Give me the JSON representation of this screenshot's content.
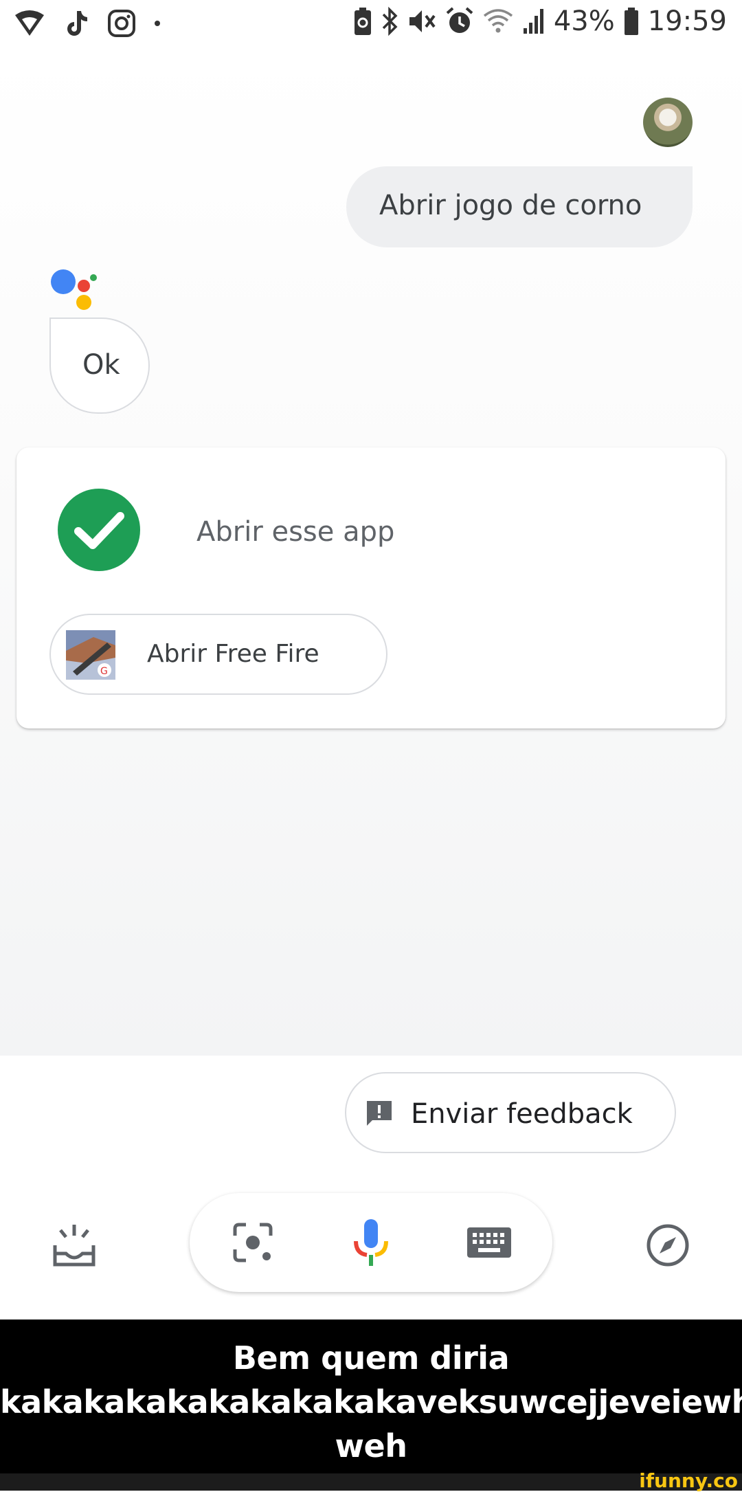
{
  "status_bar": {
    "left_icons": [
      "wifi-shield-icon",
      "tiktok-icon",
      "instagram-icon",
      "dot-icon"
    ],
    "right_icons": [
      "battery-saver-icon",
      "bluetooth-icon",
      "mute-icon",
      "alarm-icon",
      "wifi-icon",
      "signal-icon",
      "battery-icon"
    ],
    "battery": "43%",
    "time": "19:59"
  },
  "conversation": {
    "user_message": "Abrir jogo de corno",
    "assistant_reply": "Ok"
  },
  "action_card": {
    "title": "Abrir esse app",
    "chip_label": "Abrir Free Fire",
    "status_icon": "check-circle-icon",
    "accent_color": "#1e9e55"
  },
  "feedback": {
    "label": "Enviar feedback",
    "icon": "feedback-icon"
  },
  "bottom_bar": {
    "buttons": [
      "updates-icon",
      "lens-icon",
      "mic-icon",
      "keyboard-icon",
      "explore-icon"
    ]
  },
  "caption": {
    "line1": "Bem quem diria",
    "line2": "kakakakakakakakakakaveksuwcejjeveiewhj",
    "line3": "weh"
  },
  "watermark": "ifunny.co"
}
